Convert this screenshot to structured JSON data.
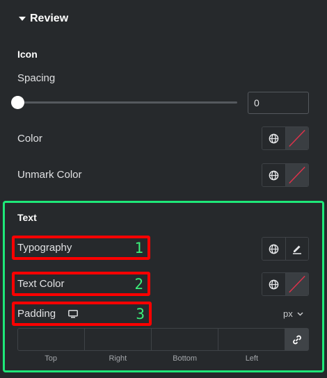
{
  "review": {
    "title": "Review"
  },
  "icon_section": {
    "title": "Icon",
    "spacing": {
      "label": "Spacing",
      "value": "0",
      "slider_level": 0
    },
    "color": {
      "label": "Color"
    },
    "unmark_color": {
      "label": "Unmark Color"
    }
  },
  "text_section": {
    "title": "Text",
    "typography": {
      "label": "Typography",
      "marker": "1"
    },
    "text_color": {
      "label": "Text Color",
      "marker": "2"
    },
    "padding": {
      "label": "Padding",
      "marker": "3",
      "unit": "px",
      "device_icon": "desktop-icon"
    },
    "dimensions": {
      "labels": [
        "Top",
        "Right",
        "Bottom",
        "Left"
      ],
      "values": [
        "",
        "",
        "",
        ""
      ]
    }
  },
  "colors": {
    "background": "#26292c",
    "highlight_green": "#1ee879",
    "highlight_red": "#ff0000",
    "marker_green": "#3bf07a",
    "swatch_slash": "#e0324b"
  },
  "icons": {
    "global": "globe-icon",
    "edit": "pencil-icon",
    "link": "link-icon",
    "caret": "caret-down-icon",
    "chevron": "chevron-down-icon"
  }
}
